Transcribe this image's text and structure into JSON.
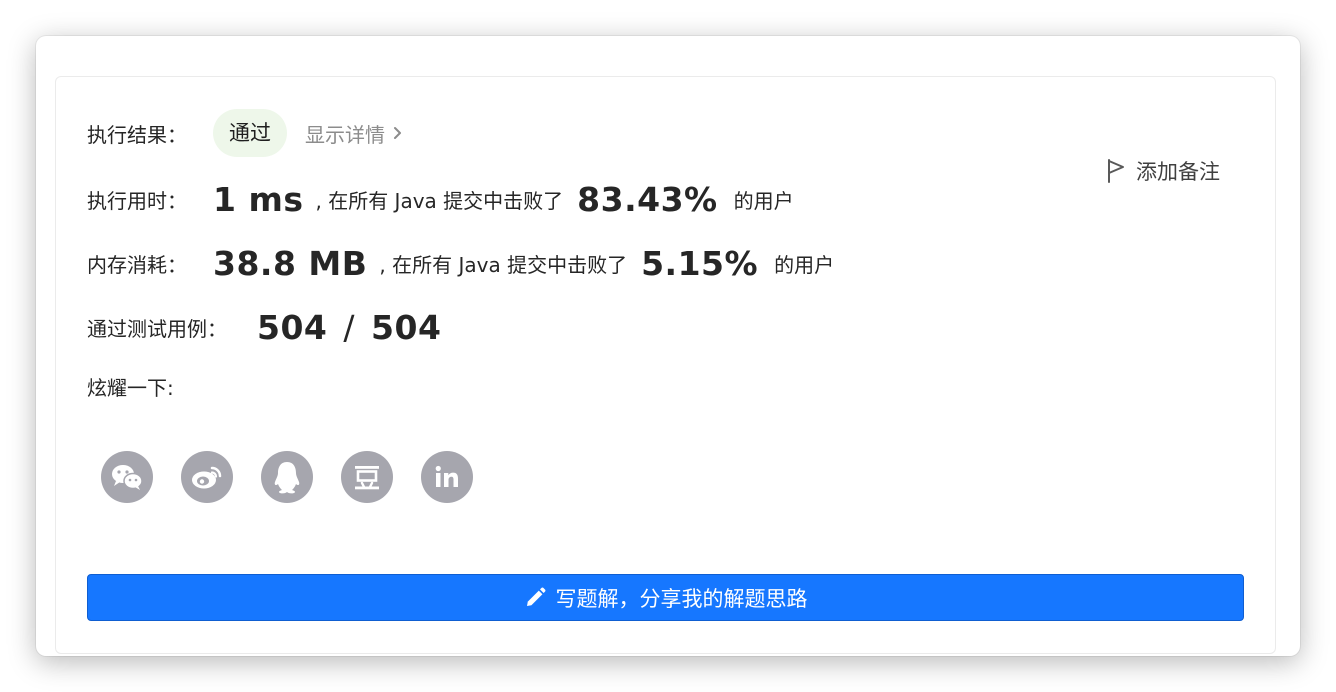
{
  "result": {
    "label": "执行结果：",
    "status": "通过",
    "details_link": "显示详情",
    "add_note": "添加备注"
  },
  "runtime": {
    "label": "执行用时：",
    "value": "1 ms",
    "text_before": ", 在所有 Java 提交中击败了",
    "percent": "83.43%",
    "text_after": "的用户"
  },
  "memory": {
    "label": "内存消耗：",
    "value": "38.8 MB",
    "text_before": ", 在所有 Java 提交中击败了",
    "percent": "5.15%",
    "text_after": "的用户"
  },
  "testcases": {
    "label": "通过测试用例：",
    "passed": "504",
    "separator": "/",
    "total": "504"
  },
  "share": {
    "label": "炫耀一下:",
    "icons": [
      "wechat-icon",
      "weibo-icon",
      "qq-icon",
      "douban-icon",
      "linkedin-icon"
    ]
  },
  "cta": {
    "label": "写题解，分享我的解题思路"
  },
  "colors": {
    "accent": "#1677ff",
    "pass_badge_bg": "#eef7ea",
    "share_icon_bg": "#a6a6ae"
  }
}
